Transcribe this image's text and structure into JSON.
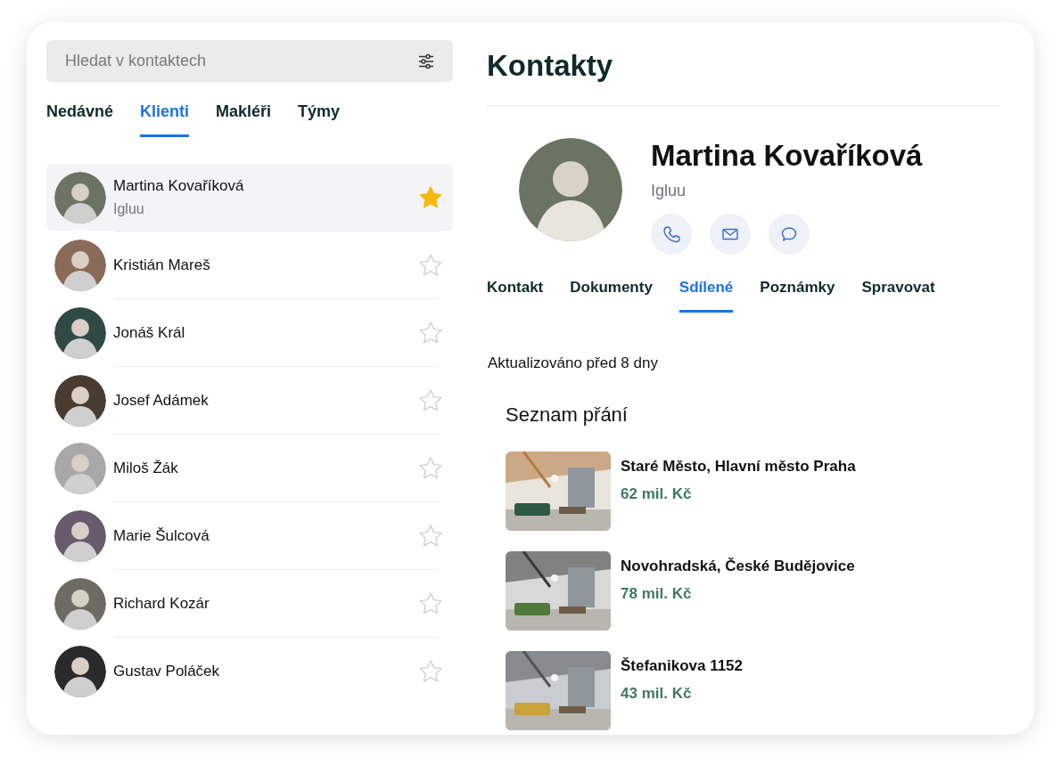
{
  "search": {
    "placeholder": "Hledat v kontaktech"
  },
  "list_tabs": [
    {
      "label": "Nedávné",
      "selected": false
    },
    {
      "label": "Klienti",
      "selected": true
    },
    {
      "label": "Makléři",
      "selected": false
    },
    {
      "label": "Týmy",
      "selected": false
    }
  ],
  "contacts": [
    {
      "name": "Martina Kovaříková",
      "subtitle": "Igluu",
      "selected": true,
      "starred": true
    },
    {
      "name": "Kristián Mareš",
      "selected": false,
      "starred": false
    },
    {
      "name": "Jonáš Král",
      "selected": false,
      "starred": false
    },
    {
      "name": "Josef Adámek",
      "selected": false,
      "starred": false
    },
    {
      "name": "Miloš Žák",
      "selected": false,
      "starred": false
    },
    {
      "name": "Marie Šulcová",
      "selected": false,
      "starred": false
    },
    {
      "name": "Richard Kozár",
      "selected": false,
      "starred": false
    },
    {
      "name": "Gustav Poláček",
      "selected": false,
      "starred": false
    }
  ],
  "page_title": "Kontakty",
  "profile": {
    "name": "Martina Kovaříková",
    "company": "Igluu",
    "actions": [
      {
        "kind": "phone"
      },
      {
        "kind": "email"
      },
      {
        "kind": "chat"
      }
    ]
  },
  "detail_tabs": [
    {
      "label": "Kontakt",
      "selected": false
    },
    {
      "label": "Dokumenty",
      "selected": false
    },
    {
      "label": "Sdílené",
      "selected": true
    },
    {
      "label": "Poznámky",
      "selected": false
    },
    {
      "label": "Spravovat",
      "selected": false
    }
  ],
  "updated": "Aktualizováno před 8 dny",
  "wishlist": {
    "title": "Seznam přání",
    "items": [
      {
        "address": "Staré Město, Hlavní město Praha",
        "price": "62 mil. Kč",
        "kind": "picture"
      },
      {
        "address": "Novohradská, České Budějovice",
        "price": "78 mil. Kč",
        "kind": "picture"
      },
      {
        "address": "Štefanikova 1152",
        "price": "43 mil. Kč",
        "kind": "picture"
      }
    ]
  }
}
